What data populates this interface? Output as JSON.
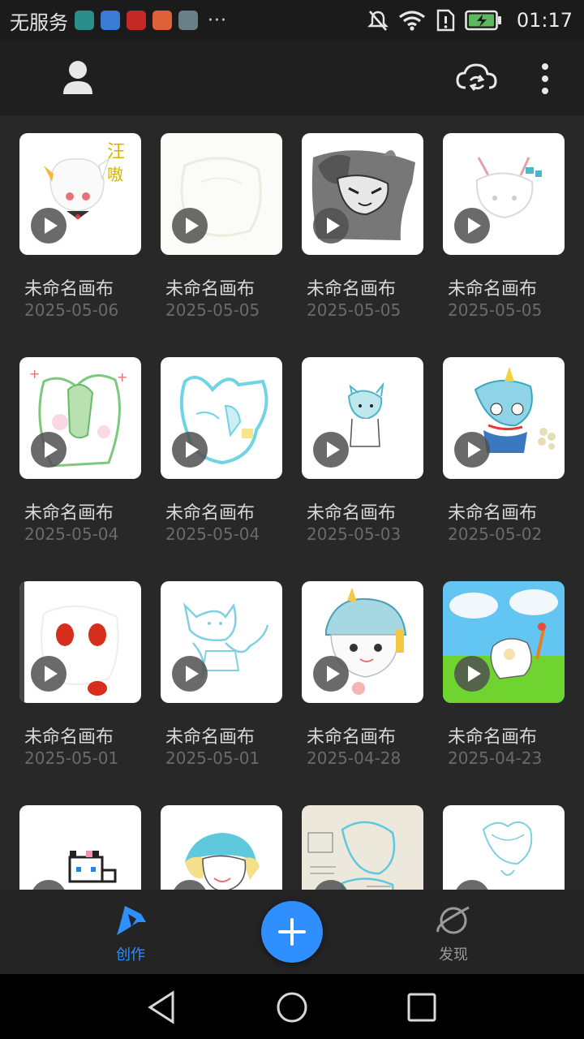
{
  "status_bar": {
    "carrier": "无服务",
    "time": "01:17",
    "overflow": "···",
    "app_icons": [
      {
        "name": "moon-app-icon",
        "color": "#2a8f8a"
      },
      {
        "name": "health-app-icon",
        "color": "#3a7bd5"
      },
      {
        "name": "huawei-app-icon",
        "color": "#c62828"
      },
      {
        "name": "screen-recorder-icon",
        "color": "#e0603a"
      },
      {
        "name": "gallery-app-icon",
        "color": "#6a7f88"
      }
    ],
    "right_icons": [
      "mute-icon",
      "wifi-icon",
      "sim-alert-icon",
      "battery-charging-icon"
    ]
  },
  "toolbar": {
    "left_icon": "user-icon",
    "right_icons": [
      "cloud-sync-icon",
      "more-vertical-icon"
    ]
  },
  "canvases": [
    {
      "title": "未命名画布",
      "date": "2025-05-06"
    },
    {
      "title": "未命名画布",
      "date": "2025-05-05"
    },
    {
      "title": "未命名画布",
      "date": "2025-05-05"
    },
    {
      "title": "未命名画布",
      "date": "2025-05-05"
    },
    {
      "title": "未命名画布",
      "date": "2025-05-04"
    },
    {
      "title": "未命名画布",
      "date": "2025-05-04"
    },
    {
      "title": "未命名画布",
      "date": "2025-05-03"
    },
    {
      "title": "未命名画布",
      "date": "2025-05-02"
    },
    {
      "title": "未命名画布",
      "date": "2025-05-01"
    },
    {
      "title": "未命名画布",
      "date": "2025-05-01"
    },
    {
      "title": "未命名画布",
      "date": "2025-04-28"
    },
    {
      "title": "未命名画布",
      "date": "2025-04-23"
    },
    {
      "title": "",
      "date": ""
    },
    {
      "title": "",
      "date": ""
    },
    {
      "title": "",
      "date": ""
    },
    {
      "title": "",
      "date": ""
    }
  ],
  "bottom_nav": {
    "create_label": "创作",
    "discover_label": "发现",
    "active_color": "#2f8fff",
    "inactive_color": "#9a9a9a"
  },
  "system_nav": [
    "back-icon",
    "home-icon",
    "recents-icon"
  ]
}
